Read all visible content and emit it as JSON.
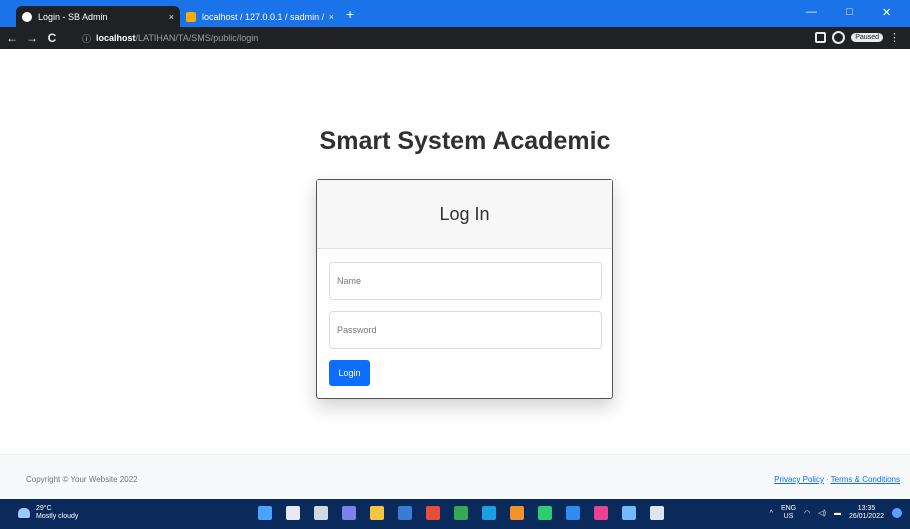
{
  "browser": {
    "tabs": [
      {
        "title": "Login - SB Admin",
        "close": "×"
      },
      {
        "title": "localhost / 127.0.0.1 / sadmin / ...",
        "close": "×"
      }
    ],
    "new_tab": "+",
    "window_controls": [
      "—",
      "□",
      "✕"
    ],
    "nav": {
      "back": "←",
      "forward": "→",
      "reload": "C"
    },
    "address": {
      "info": "ⓘ",
      "host": "localhost",
      "path": "/LATIHAN/TA/SMS/public/login"
    },
    "paused_label": "Paused",
    "menu": "⋮"
  },
  "page": {
    "title": "Smart System Academic",
    "card_title": "Log In",
    "name_placeholder": "Name",
    "password_placeholder": "Password",
    "login_button": "Login"
  },
  "footer": {
    "copyright": "Copyright © Your Website 2022",
    "privacy": "Privacy Policy",
    "separator": "·",
    "terms": "Terms & Conditions"
  },
  "taskbar": {
    "weather_temp": "29°C",
    "weather_desc": "Mostly cloudy",
    "tray_lang": "ENG",
    "tray_region": "US",
    "time": "13:35",
    "date": "26/01/2022",
    "app_icons": [
      {
        "name": "start-icon",
        "color": "#4aa3ff"
      },
      {
        "name": "search-icon",
        "color": "#e8eaed"
      },
      {
        "name": "task-view-icon",
        "color": "#cfd8e3"
      },
      {
        "name": "chat-icon",
        "color": "#7b83eb"
      },
      {
        "name": "file-explorer-icon",
        "color": "#f4c542"
      },
      {
        "name": "store-icon",
        "color": "#3a7bd5"
      },
      {
        "name": "app-icon",
        "color": "#e74c3c"
      },
      {
        "name": "chrome-icon",
        "color": "#34a853"
      },
      {
        "name": "edge-icon",
        "color": "#1ba1e2"
      },
      {
        "name": "app-icon",
        "color": "#f0932b"
      },
      {
        "name": "app-icon",
        "color": "#2ecc71"
      },
      {
        "name": "vscode-icon",
        "color": "#2d8cf0"
      },
      {
        "name": "app-icon",
        "color": "#e84393"
      },
      {
        "name": "app-icon",
        "color": "#74b9ff"
      },
      {
        "name": "app-icon",
        "color": "#dfe6e9"
      }
    ]
  }
}
